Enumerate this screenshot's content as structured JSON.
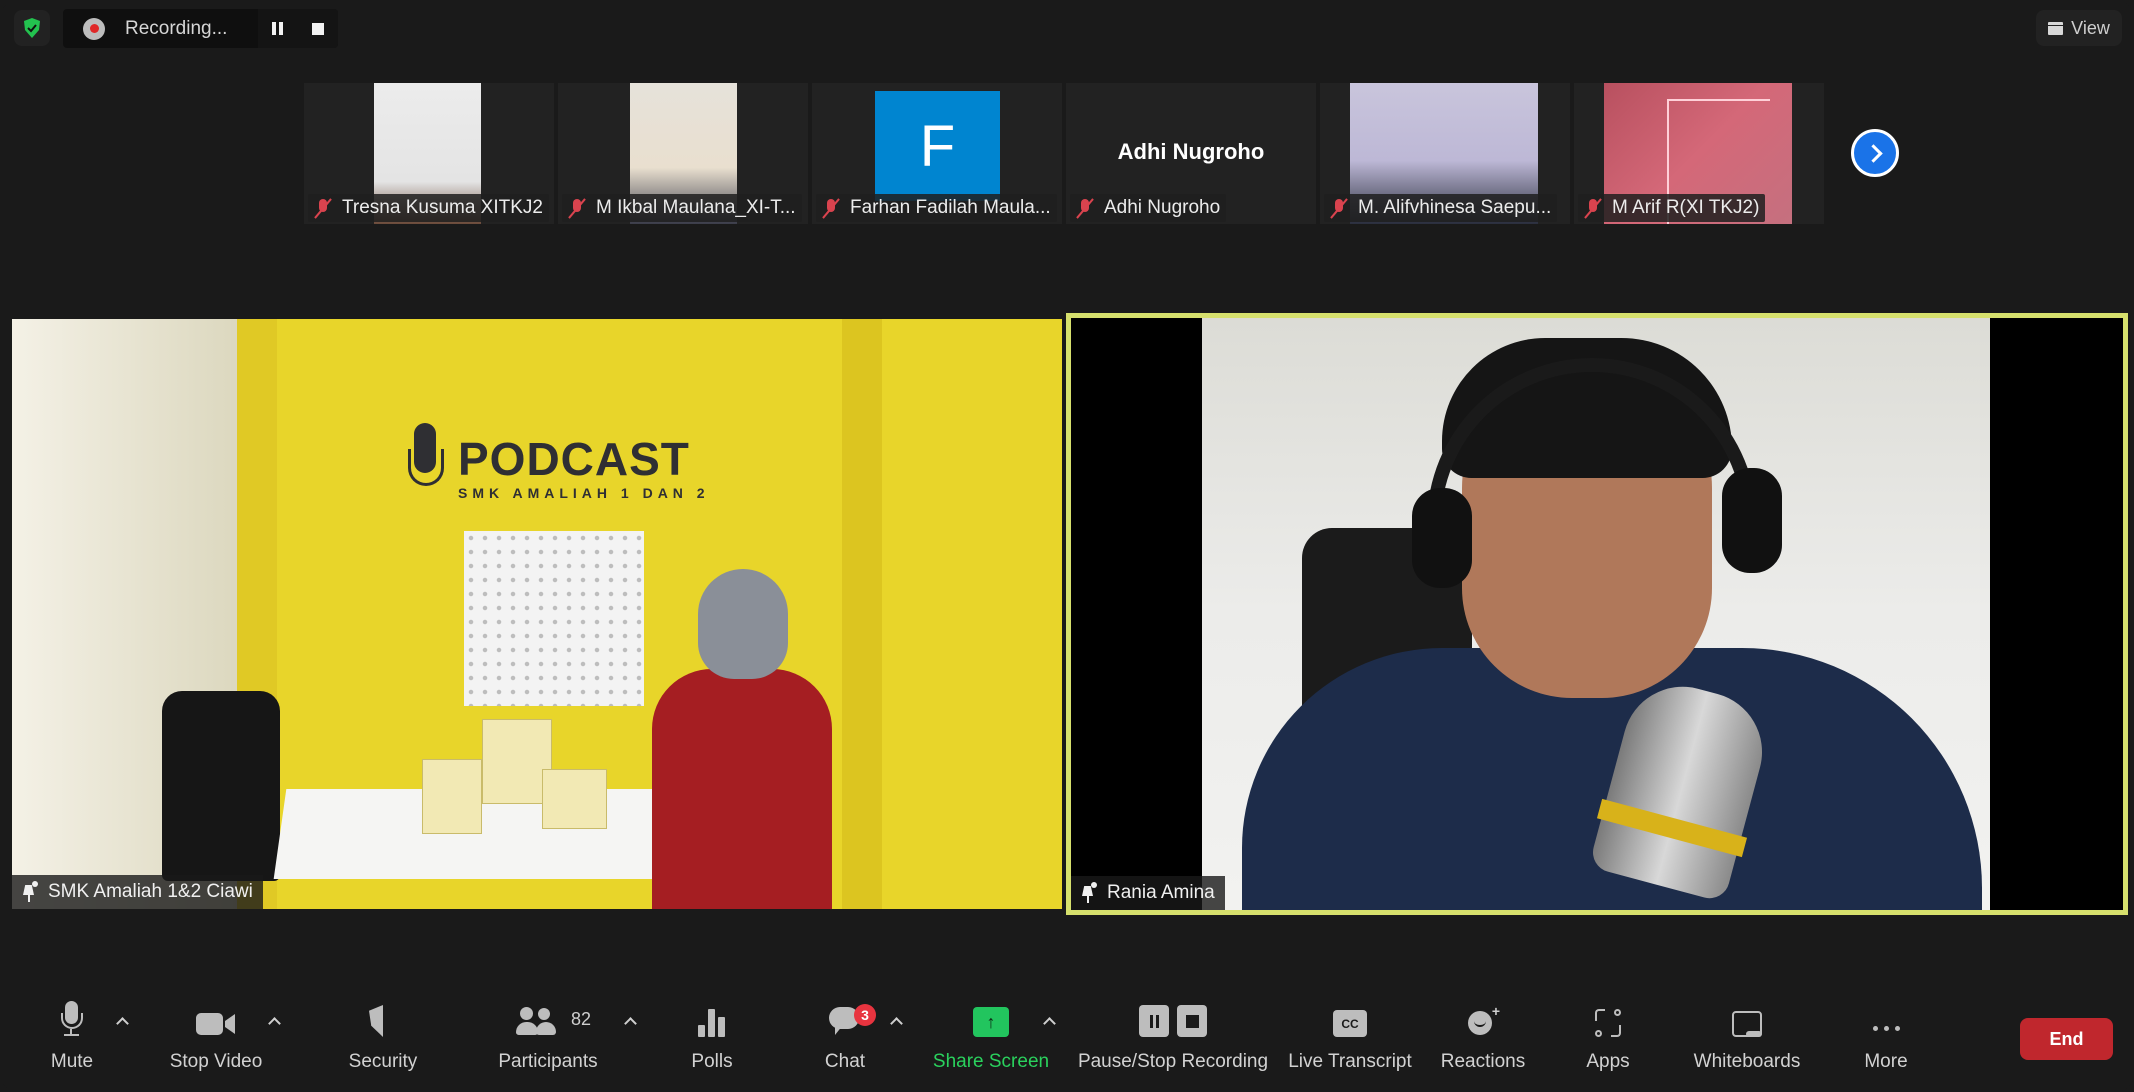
{
  "top_bar": {
    "security_status": "encrypted",
    "recording_label": "Recording...",
    "view_label": "View"
  },
  "thumbnails": [
    {
      "name": "Tresna Kusuma XITKJ2",
      "muted": true,
      "video": "camera"
    },
    {
      "name": "M Ikbal Maulana_XI-T...",
      "muted": true,
      "video": "camera"
    },
    {
      "name": "Farhan Fadilah Maula...",
      "muted": true,
      "video": "avatar",
      "avatar_letter": "F",
      "avatar_color": "#0085d0"
    },
    {
      "name": "Adhi Nugroho",
      "muted": true,
      "video": "off",
      "display_name": "Adhi Nugroho"
    },
    {
      "name": "M. Alifvhinesa Saepu...",
      "muted": true,
      "video": "camera"
    },
    {
      "name": "M Arif R(XI TKJ2)",
      "muted": true,
      "video": "camera"
    }
  ],
  "main_videos": [
    {
      "name": "SMK Amaliah 1&2 Ciawi",
      "pinned": true,
      "active_speaker": false,
      "scene": {
        "logo_title": "PODCAST",
        "logo_subtitle": "SMK AMALIAH 1 DAN 2"
      }
    },
    {
      "name": "Rania Amina",
      "pinned": true,
      "active_speaker": true,
      "active_color": "#d6e06d"
    }
  ],
  "toolbar": {
    "items": [
      {
        "id": "mute",
        "label": "Mute",
        "icon": "microphone-icon",
        "has_caret": true
      },
      {
        "id": "video",
        "label": "Stop Video",
        "icon": "video-camera-icon",
        "has_caret": true
      },
      {
        "id": "security",
        "label": "Security",
        "icon": "shield-icon",
        "has_caret": false
      },
      {
        "id": "participants",
        "label": "Participants",
        "icon": "participants-icon",
        "count": "82",
        "has_caret": true
      },
      {
        "id": "polls",
        "label": "Polls",
        "icon": "polls-icon",
        "has_caret": false
      },
      {
        "id": "chat",
        "label": "Chat",
        "icon": "chat-icon",
        "badge": "3",
        "has_caret": true
      },
      {
        "id": "share",
        "label": "Share Screen",
        "icon": "share-screen-icon",
        "has_caret": true,
        "color": "#2ad15d"
      },
      {
        "id": "recording",
        "label": "Pause/Stop Recording",
        "icon": "pause-stop-icon",
        "has_caret": false
      },
      {
        "id": "transcript",
        "label": "Live Transcript",
        "icon": "cc-icon",
        "icon_text": "CC",
        "has_caret": false
      },
      {
        "id": "reactions",
        "label": "Reactions",
        "icon": "reactions-icon",
        "has_caret": false
      },
      {
        "id": "apps",
        "label": "Apps",
        "icon": "apps-icon",
        "has_caret": false
      },
      {
        "id": "whiteboards",
        "label": "Whiteboards",
        "icon": "whiteboard-icon",
        "has_caret": false
      },
      {
        "id": "more",
        "label": "More",
        "icon": "more-icon",
        "has_caret": false
      }
    ],
    "end_label": "End",
    "end_color": "#c0272d"
  }
}
